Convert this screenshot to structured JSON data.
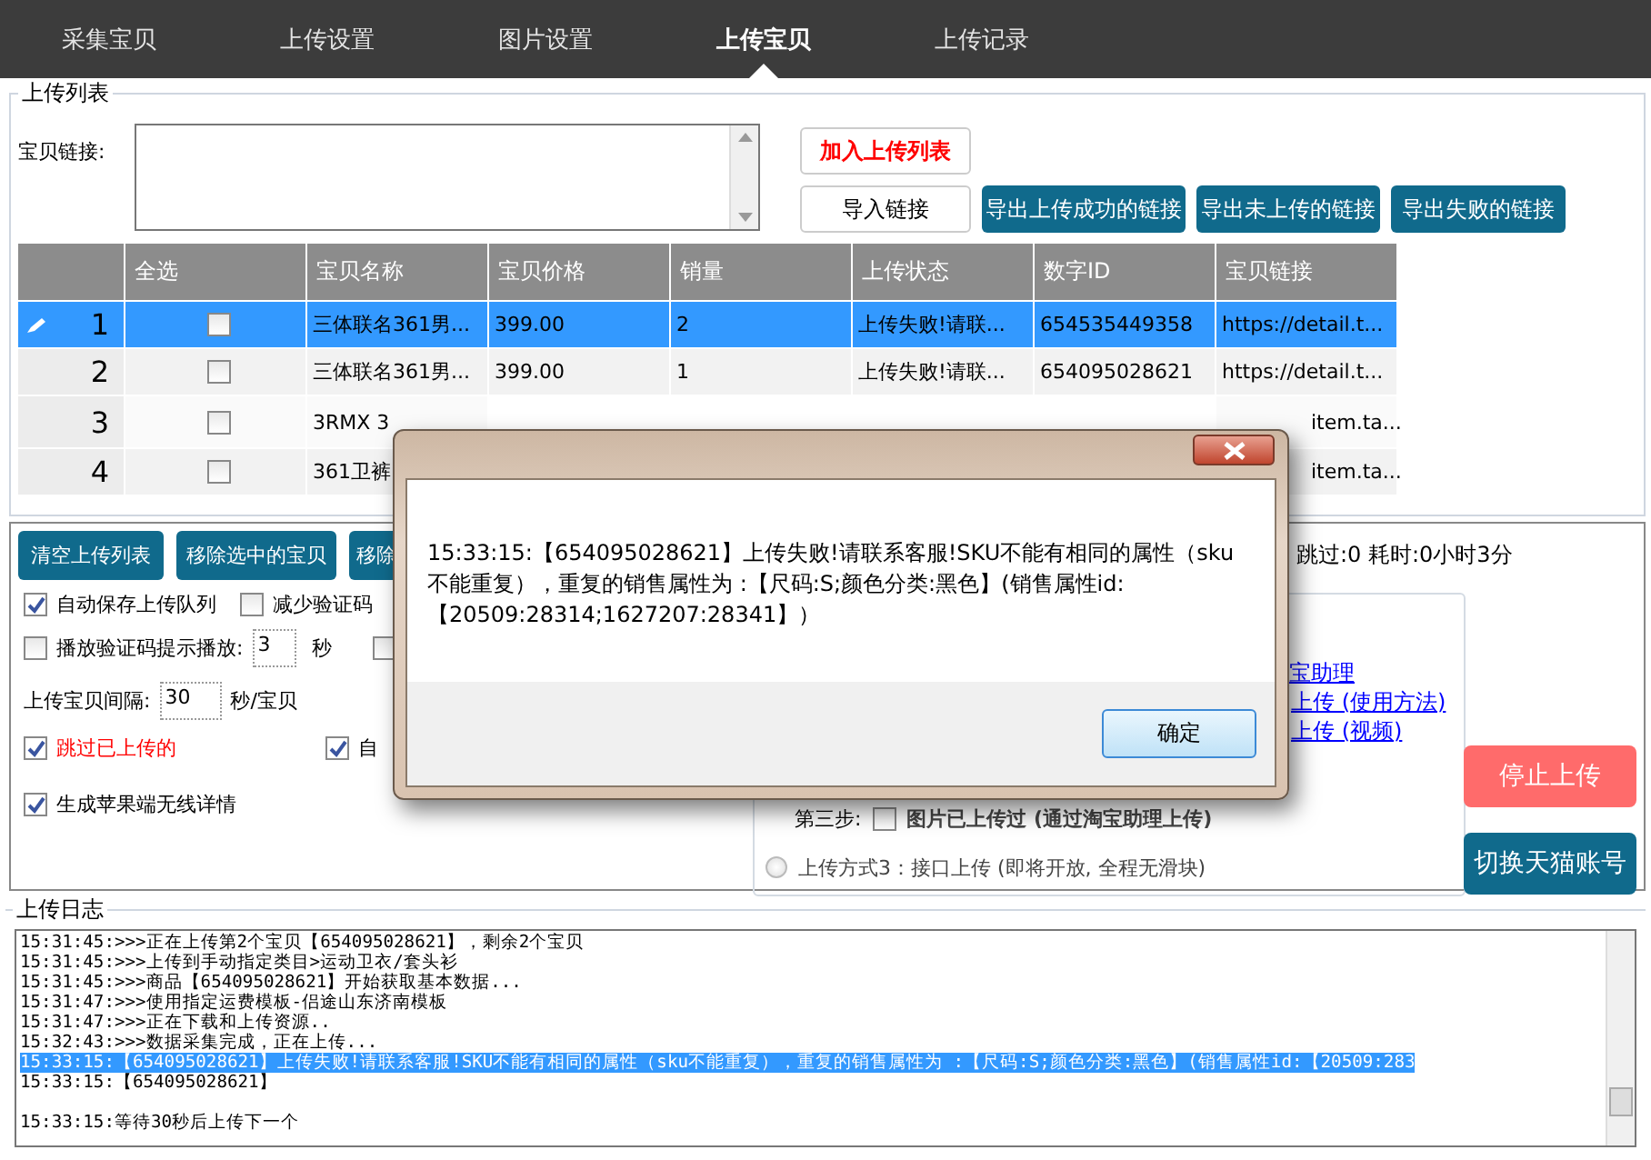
{
  "nav": {
    "tabs": [
      {
        "label": "采集宝贝",
        "selected": false
      },
      {
        "label": "上传设置",
        "selected": false
      },
      {
        "label": "图片设置",
        "selected": false
      },
      {
        "label": "上传宝贝",
        "selected": true
      },
      {
        "label": "上传记录",
        "selected": false
      }
    ]
  },
  "upload_list": {
    "title": "上传列表",
    "link_label": "宝贝链接:",
    "add_button": "加入上传列表",
    "import_button": "导入链接",
    "export_buttons": [
      "导出上传成功的链接",
      "导出未上传的链接",
      "导出失败的链接"
    ],
    "table": {
      "columns": [
        "全选",
        "宝贝名称",
        "宝贝价格",
        "销量",
        "上传状态",
        "数字ID",
        "宝贝链接"
      ],
      "rows": [
        {
          "number": "1",
          "selected": true,
          "checked": false,
          "partly_hidden": false,
          "name": "三体联名361男...",
          "price": "399.00",
          "sales": "2",
          "status": "上传失败!请联...",
          "id": "654535449358",
          "link": "https://detail.t..."
        },
        {
          "number": "2",
          "selected": false,
          "checked": false,
          "partly_hidden": false,
          "name": "三体联名361男...",
          "price": "399.00",
          "sales": "1",
          "status": "上传失败!请联...",
          "id": "654095028621",
          "link": "https://detail.t..."
        },
        {
          "number": "3",
          "selected": false,
          "checked": false,
          "partly_hidden": true,
          "name": "3RMX 3",
          "link": "item.ta..."
        },
        {
          "number": "4",
          "selected": false,
          "checked": false,
          "partly_hidden": true,
          "name": "361卫裤",
          "link": "item.ta..."
        }
      ]
    }
  },
  "actions": {
    "buttons": [
      "清空上传列表",
      "移除选中的宝贝",
      "移除"
    ],
    "stats": "跳过:0  耗时:0小时3分"
  },
  "options": {
    "auto_save": {
      "label": "自动保存上传队列",
      "checked": true
    },
    "reduce_captcha": {
      "label": "减少验证码",
      "checked": false
    },
    "play_captcha": {
      "label": "播放验证码提示播放:",
      "checked": false,
      "value": "3",
      "unit": "秒"
    },
    "hidden_option": {
      "checked": false
    },
    "interval": {
      "label": "上传宝贝间隔:",
      "value": "30",
      "unit": "秒/宝贝"
    },
    "skip_uploaded": {
      "label": "跳过已上传的",
      "checked": true
    },
    "auto_option": {
      "label": "自",
      "checked": true
    },
    "apple_detail": {
      "label": "生成苹果端无线详情",
      "checked": true
    }
  },
  "methods": {
    "links": [
      "宝助理",
      "上传 (使用方法)",
      "上传 (视频)"
    ],
    "step3_label": "第三步:",
    "step3_option": {
      "label": "图片已上传过 (通过淘宝助理上传)",
      "checked": false
    },
    "method3": {
      "label": "上传方式3：接口上传 (即将开放, 全程无滑块)",
      "selected": false
    }
  },
  "side_buttons": [
    "停止上传",
    "切换天猫账号"
  ],
  "log": {
    "title": "上传日志",
    "lines": [
      {
        "text": "15:31:45:>>>正在上传第2个宝贝【654095028621】，剩余2个宝贝",
        "selected": false
      },
      {
        "text": "15:31:45:>>>上传到手动指定类目>运动卫衣/套头衫",
        "selected": false
      },
      {
        "text": "15:31:45:>>>商品【654095028621】开始获取基本数据...",
        "selected": false
      },
      {
        "text": "15:31:47:>>>使用指定运费模板-侣途山东济南模板",
        "selected": false
      },
      {
        "text": "15:31:47:>>>正在下载和上传资源..",
        "selected": false
      },
      {
        "text": "15:32:43:>>>数据采集完成，正在上传...",
        "selected": false
      },
      {
        "text": "15:33:15:【654095028621】上传失败!请联系客服!SKU不能有相同的属性（sku不能重复），重复的销售属性为 :【尺码:S;颜色分类:黑色】(销售属性id:【20509:283",
        "selected": true
      },
      {
        "text": "15:33:15:【654095028621】",
        "selected": false
      },
      {
        "text": "15:33:15:等待30秒后上传下一个",
        "selected": false,
        "blank_before": true
      }
    ]
  },
  "dialog": {
    "message": "15:33:15:【654095028621】上传失败!请联系客服!SKU不能有相同的属性（sku不能重复），重复的销售属性为 :【尺码:S;颜色分类:黑色】(销售属性id:【20509:28314;1627207:28341】）",
    "ok_button": "确定"
  }
}
